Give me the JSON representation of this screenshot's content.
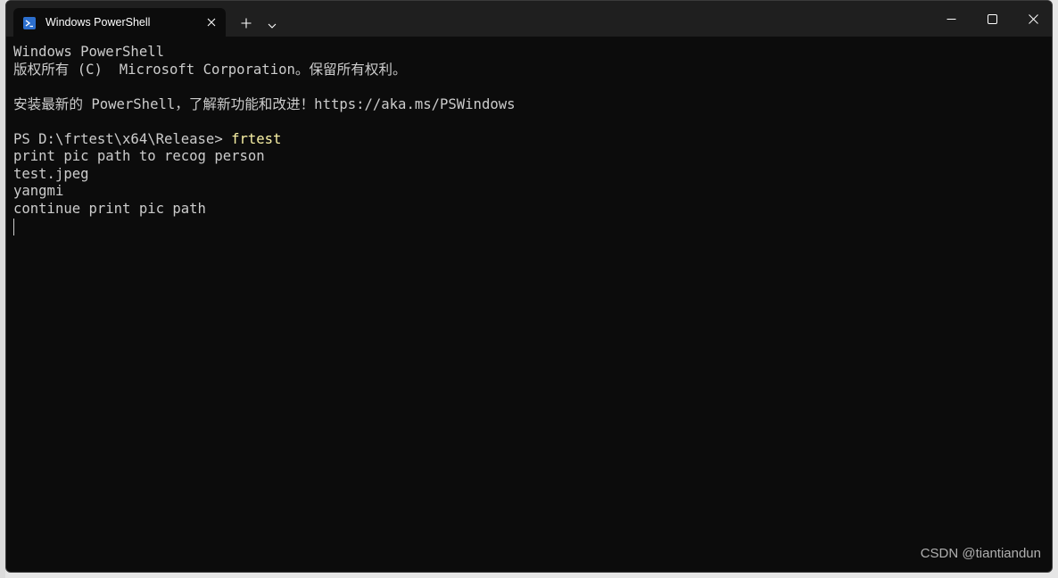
{
  "window": {
    "tab_title": "Windows PowerShell",
    "tab_icon": "powershell-icon",
    "close_tab_icon": "close-icon",
    "new_tab_icon": "plus-icon",
    "dropdown_icon": "chevron-down-icon",
    "minimize_icon": "minimize-icon",
    "maximize_icon": "maximize-icon",
    "close_window_icon": "close-icon"
  },
  "terminal": {
    "line1": "Windows PowerShell",
    "line2": "版权所有 (C)  Microsoft Corporation。保留所有权利。",
    "line3": "",
    "line4": "安装最新的 PowerShell，了解新功能和改进！https://aka.ms/PSWindows",
    "line5": "",
    "prompt": "PS D:\\frtest\\x64\\Release> ",
    "command": "frtest",
    "line7": "print pic path to recog person",
    "line8": "test.jpeg",
    "line9": "yangmi",
    "line10": "continue print pic path"
  },
  "watermark": "CSDN @tiantiandun",
  "colors": {
    "terminal_bg": "#0c0c0c",
    "titlebar_bg": "#1f1f1f",
    "text": "#cccccc",
    "command_text": "#f9f1a5"
  }
}
